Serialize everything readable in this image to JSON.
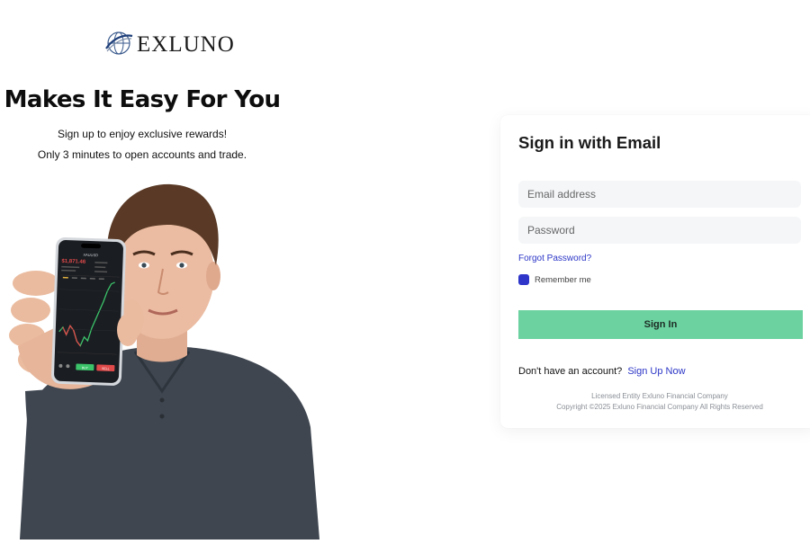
{
  "brand": {
    "name": "EXLUNO",
    "logo_icon": "globe-swoosh-icon"
  },
  "hero": {
    "headline": "Makes It Easy For You",
    "subtitle_1": "Sign up to enjoy exclusive rewards!",
    "subtitle_2": "Only 3 minutes to open accounts and trade.",
    "image": "man-holding-phone-with-trading-chart",
    "phone_screen": {
      "pair": "XAUUSD",
      "price": "$1,871.46",
      "buy_label": "BUY",
      "sell_label": "SELL"
    }
  },
  "signin_card": {
    "title": "Sign in with Email",
    "email_placeholder": "Email address",
    "password_placeholder": "Password",
    "forgot_password": "Forgot Password?",
    "remember_me": "Remember me",
    "remember_checked": true,
    "submit_label": "Sign In",
    "no_account_text": "Don't have an account?",
    "signup_link": "Sign Up Now",
    "legal_line_1": "Licensed Entity Exluno Financial Company",
    "legal_line_2": "Copyright ©2025 Exluno Financial Company All Rights Reserved"
  },
  "colors": {
    "accent_blue": "#2c36c6",
    "button_green": "#6bd2a0",
    "input_bg": "#f4f6f8"
  }
}
